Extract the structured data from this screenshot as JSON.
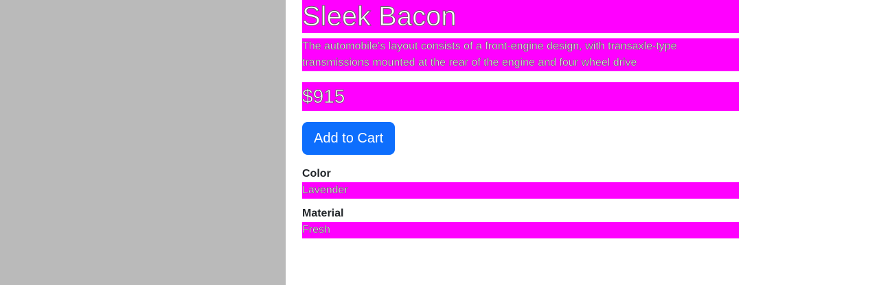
{
  "product": {
    "name": "Sleek Bacon",
    "description": "The automobile's layout consists of a front-engine design, with transaxle-type transmissions mounted at the rear of the engine and four wheel drive",
    "price": "$915",
    "add_to_cart_label": "Add to Cart",
    "attributes": [
      {
        "label": "Color",
        "value": "Lavender"
      },
      {
        "label": "Material",
        "value": "Fresh"
      }
    ]
  },
  "colors": {
    "highlight": "#ff00ff",
    "primary_button": "#0d6efd",
    "image_placeholder": "#bababa"
  }
}
